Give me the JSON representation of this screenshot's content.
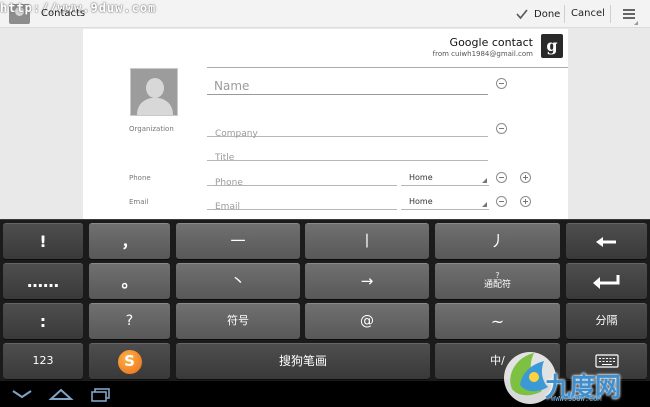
{
  "actionbar": {
    "watermark_url": "http://www.9duw.com",
    "title": "Contacts",
    "done_label": "Done",
    "cancel_label": "Cancel"
  },
  "account": {
    "type": "Google contact",
    "email": "from cuiwh1984@gmail.com",
    "logo_letter": "g"
  },
  "form": {
    "name_placeholder": "Name",
    "organization_label": "Organization",
    "company_placeholder": "Company",
    "title_placeholder": "Title",
    "phone_label": "Phone",
    "phone_placeholder": "Phone",
    "phone_type": "Home",
    "email_label": "Email",
    "email_placeholder": "Email",
    "email_type": "Home"
  },
  "keyboard": {
    "row1": [
      "!",
      "，",
      "一",
      "丨",
      "丿"
    ],
    "row2": [
      "……",
      "。",
      "丶",
      "→"
    ],
    "wildcard_top": "?",
    "wildcard_bottom": "通配符",
    "row3": [
      ":",
      "?",
      "符号",
      "@",
      "~",
      "分隔"
    ],
    "numbers_key": "123",
    "sogou_logo": "S",
    "space_label": "搜狗笔画",
    "lang_key": "中/"
  },
  "watermark": {
    "text": "九度网",
    "url": "WWW.9DUW.COM"
  }
}
